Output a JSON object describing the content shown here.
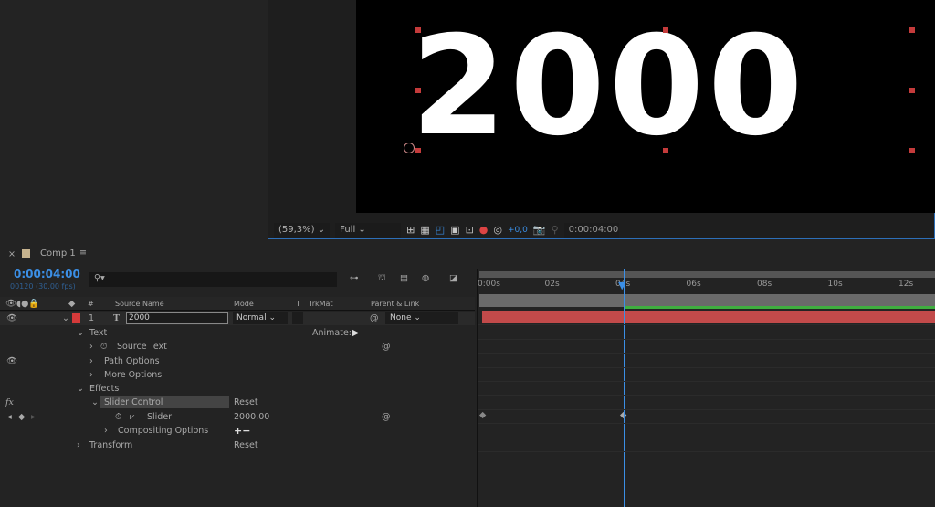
{
  "viewer": {
    "comp_text": "2000",
    "zoom": "(59,3%)",
    "resolution": "Full",
    "exposure": "+0,0",
    "timecode": "0:00:04:00"
  },
  "timeline": {
    "tab_title": "Comp 1",
    "current_time": "0:00:04:00",
    "frame_info": "00120 (30.00 fps)",
    "search_placeholder": "",
    "columns": {
      "num": "#",
      "source_name": "Source Name",
      "mode": "Mode",
      "t": "T",
      "trkmat": "TrkMat",
      "parent": "Parent & Link"
    },
    "layer": {
      "number": "1",
      "name": "2000",
      "mode": "Normal",
      "parent": "None",
      "label_color": "#d43a3a"
    },
    "properties": [
      {
        "label": "Text",
        "extra": "Animate:",
        "expanded": true
      },
      {
        "label": "Source Text"
      },
      {
        "label": "Path Options"
      },
      {
        "label": "More Options"
      },
      {
        "label": "Effects",
        "expanded": true
      },
      {
        "label": "Slider Control",
        "extra": "Reset"
      },
      {
        "label": "Slider",
        "value": "2000,00"
      },
      {
        "label": "Compositing Options",
        "extra": "+−"
      },
      {
        "label": "Transform",
        "extra": "Reset"
      }
    ],
    "ruler": [
      "0:00s",
      "02s",
      "04s",
      "06s",
      "08s",
      "10s",
      "12s"
    ],
    "playhead_seconds": 4,
    "accent": "#3b8fe6",
    "layer_bar_color": "#c24a4a"
  }
}
